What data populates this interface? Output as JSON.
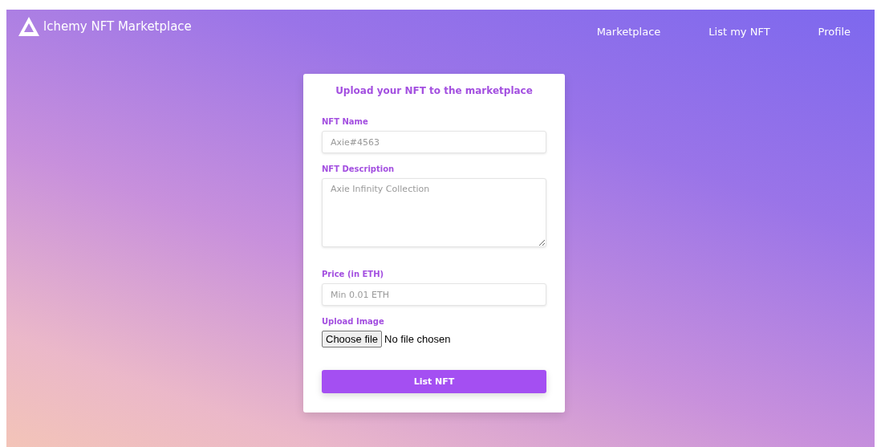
{
  "navbar": {
    "brand": "lchemy NFT Marketplace",
    "links": [
      "Marketplace",
      "List my NFT",
      "Profile"
    ]
  },
  "form": {
    "title": "Upload your NFT to the marketplace",
    "fields": [
      {
        "kind": "input",
        "label": "NFT Name",
        "placeholder": "Axie#4563"
      },
      {
        "kind": "textarea",
        "label": "NFT Description",
        "placeholder": "Axie Infinity Collection"
      },
      {
        "kind": "input",
        "label": "Price (in ETH)",
        "placeholder": "Min 0.01 ETH"
      },
      {
        "kind": "file",
        "label": "Upload Image",
        "button": "Choose file",
        "status": "No file chosen"
      }
    ],
    "submit": "List NFT"
  }
}
